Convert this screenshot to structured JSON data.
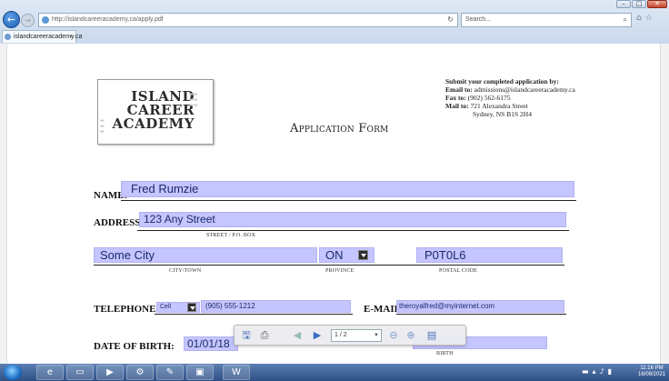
{
  "browser": {
    "url": "http://islandcareeracademy.ca/apply.pdf",
    "search_placeholder": "Search...",
    "tab_title": "islandcareeracademy.ca",
    "tab_close": "×",
    "back_icon": "back-arrow-icon",
    "reload_glyph": "↻",
    "min_label": "–",
    "max_label": "□",
    "close_label": "✕"
  },
  "logo": {
    "line1": "ISLAND",
    "line2": "CAREER",
    "line3": "ACADEMY"
  },
  "form": {
    "title": "Application Form",
    "submit_heading": "Submit your completed application by:",
    "email_label": "Email to:",
    "email_value": "admissions@islandcareeracademy.ca",
    "fax_label": "Fax to:",
    "fax_value": "(902) 562-6175",
    "mail_label": "Mail to:",
    "mail_line1": "721 Alexandra Street",
    "mail_line2": "Sydney, NS B1S 2H4",
    "name_label": "NAME:",
    "name_value": "Fred Rumzie",
    "address_label": "ADDRESS:",
    "address_value": "123 Any Street",
    "street_sublabel": "STREET / P.O. BOX",
    "city_value": "Some City",
    "province_value": "ON",
    "postal_value": "P0T0L6",
    "city_sublabel": "CITY/TOWN",
    "province_sublabel": "PROVINCE",
    "postal_sublabel": "POSTAL CODE",
    "telephone_label": "TELEPHONE:",
    "phone_type": "Cell",
    "phone_value": "(905) 555-1212",
    "email2_label": "E-MAIL",
    "email2_value": "theroyalfred@myinternet.com",
    "dob_label": "DATE OF BIRTH:",
    "dob_value": "01/01/18",
    "birth_label": "BIRTH"
  },
  "pdf_toolbar": {
    "page_indicator": "1 / 2"
  },
  "taskbar": {
    "time": "11:16 PM",
    "date": "16/09/2021",
    "word_label": "W"
  },
  "colors": {
    "field_fill": "#c5c5ff",
    "chrome_blue": "#1f5fb3"
  }
}
